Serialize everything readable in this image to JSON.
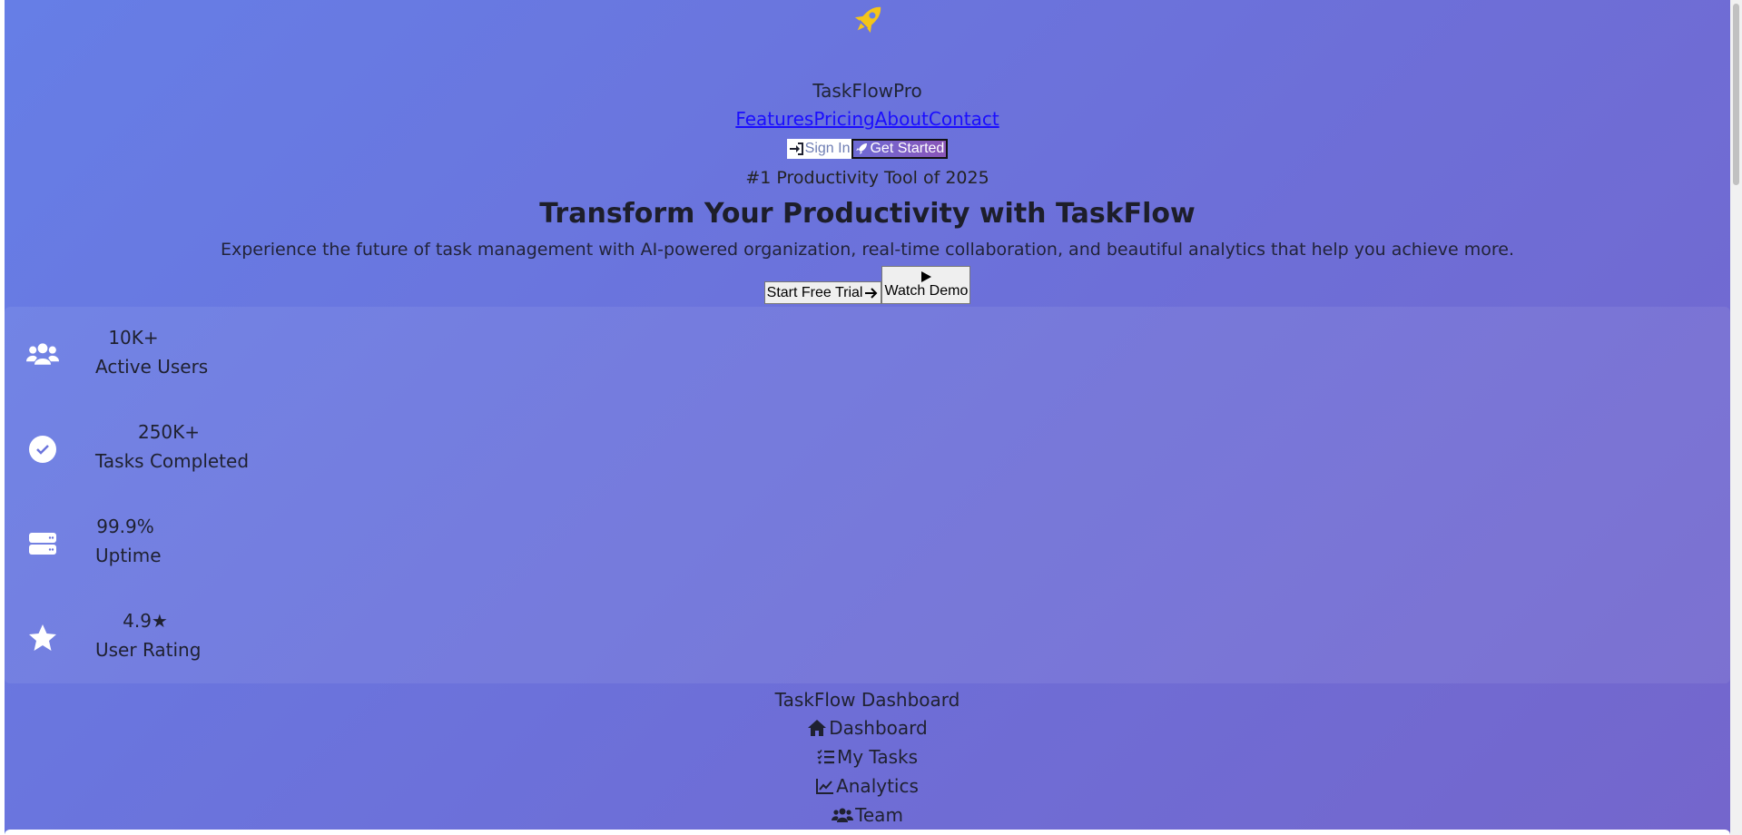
{
  "header": {
    "brand": "TaskFlowPro",
    "nav": [
      "Features",
      "Pricing",
      "About",
      "Contact"
    ],
    "sign_in": "Sign In",
    "get_started": "Get Started"
  },
  "hero": {
    "badge": "#1 Productivity Tool of 2025",
    "headline": "Transform Your Productivity with TaskFlow",
    "subtitle": "Experience the future of task management with AI-powered organization, real-time collaboration, and beautiful analytics that help you achieve more.",
    "trial_button": "Start Free Trial",
    "demo_button": "Watch Demo"
  },
  "stats": [
    {
      "value": "10K+",
      "label": "Active Users",
      "icon": "users-icon"
    },
    {
      "value": "250K+",
      "label": "Tasks Completed",
      "icon": "check-circle-icon"
    },
    {
      "value": "99.9%",
      "label": "Uptime",
      "icon": "server-icon"
    },
    {
      "value": "4.9★",
      "label": "User Rating",
      "icon": "star-icon"
    }
  ],
  "dashboard": {
    "title": "TaskFlow Dashboard",
    "menu": [
      {
        "label": "Dashboard",
        "icon": "home-icon"
      },
      {
        "label": "My Tasks",
        "icon": "task-list-icon"
      },
      {
        "label": "Analytics",
        "icon": "chart-line-icon"
      },
      {
        "label": "Team",
        "icon": "users-icon"
      }
    ]
  },
  "colors": {
    "gradient_start": "#667ee6",
    "gradient_end": "#7466cc",
    "rocket": "#f5c518",
    "link": "#1a0dff"
  }
}
